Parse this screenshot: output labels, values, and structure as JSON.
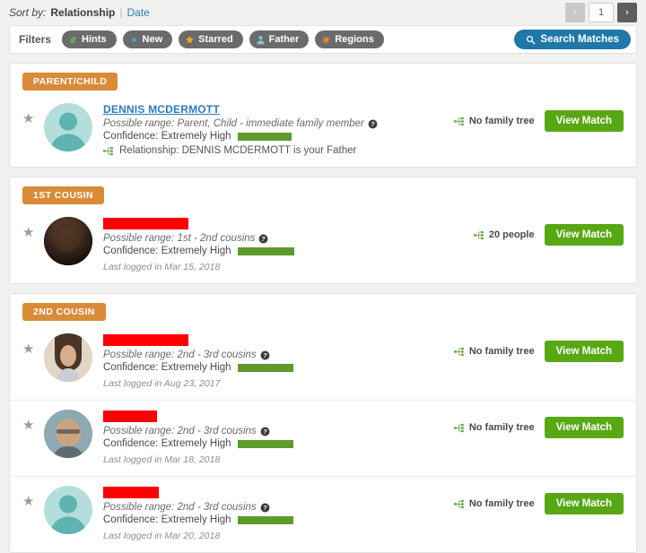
{
  "sortbar": {
    "label": "Sort by:",
    "active_option": "Relationship",
    "separator": "|",
    "other_option": "Date"
  },
  "pager": {
    "prev_glyph": "‹",
    "next_glyph": "›",
    "page_value": "1"
  },
  "filters": {
    "label": "Filters",
    "pills": [
      {
        "label": "Hints",
        "icon": "leaf-icon",
        "color": "#6aa84f"
      },
      {
        "label": "New",
        "icon": "dot-icon",
        "color": "#2bb3c0"
      },
      {
        "label": "Starred",
        "icon": "star-icon",
        "color": "#f0a818"
      },
      {
        "label": "Father",
        "icon": "person-icon",
        "color": "#7fc7cd"
      },
      {
        "label": "Regions",
        "icon": "region-icon",
        "color": "#e08a2e"
      }
    ],
    "search_button": {
      "label": "Search Matches",
      "icon": "search-icon",
      "color": "#1f78a8"
    }
  },
  "groups": [
    {
      "badge": "PARENT/CHILD",
      "matches": [
        {
          "name": "DENNIS MCDERMOTT",
          "redacted": false,
          "redact_width": 0,
          "avatar": "silhouette-male",
          "range_label": "Possible range: Parent, Child - immediate family member",
          "confidence_label": "Confidence: Extremely High",
          "confidence_bar_width": 60,
          "relationship_text": "Relationship: DENNIS MCDERMOTT is your Father",
          "last_login": "",
          "tree_status": "No family tree",
          "view_label": "View Match"
        }
      ]
    },
    {
      "badge": "1ST COUSIN",
      "matches": [
        {
          "name": "",
          "redacted": true,
          "redact_width": 95,
          "avatar": "photo-dark",
          "range_label": "Possible range: 1st - 2nd cousins",
          "confidence_label": "Confidence: Extremely High",
          "confidence_bar_width": 63,
          "relationship_text": "",
          "last_login": "Last logged in Mar 15, 2018",
          "tree_status": "20 people",
          "view_label": "View Match"
        }
      ]
    },
    {
      "badge": "2ND COUSIN",
      "matches": [
        {
          "name": "",
          "redacted": true,
          "redact_width": 95,
          "avatar": "photo-woman",
          "range_label": "Possible range: 2nd - 3rd cousins",
          "confidence_label": "Confidence: Extremely High",
          "confidence_bar_width": 62,
          "relationship_text": "",
          "last_login": "Last logged in Aug 23, 2017",
          "tree_status": "No family tree",
          "view_label": "View Match"
        },
        {
          "name": "",
          "redacted": true,
          "redact_width": 60,
          "avatar": "photo-person",
          "range_label": "Possible range: 2nd - 3rd cousins",
          "confidence_label": "Confidence: Extremely High",
          "confidence_bar_width": 62,
          "relationship_text": "",
          "last_login": "Last logged in Mar 18, 2018",
          "tree_status": "No family tree",
          "view_label": "View Match"
        },
        {
          "name": "",
          "redacted": true,
          "redact_width": 62,
          "avatar": "silhouette-male",
          "range_label": "Possible range: 2nd - 3rd cousins",
          "confidence_label": "Confidence: Extremely High",
          "confidence_bar_width": 62,
          "relationship_text": "",
          "last_login": "Last logged in Mar 20, 2018",
          "tree_status": "No family tree",
          "view_label": "View Match"
        }
      ]
    }
  ],
  "colors": {
    "badge_orange": "#d98b38",
    "confidence_green": "#5d9b2b",
    "view_button_green": "#57a813",
    "link_blue": "#2b7bb9",
    "redact_red": "#fe0000"
  }
}
